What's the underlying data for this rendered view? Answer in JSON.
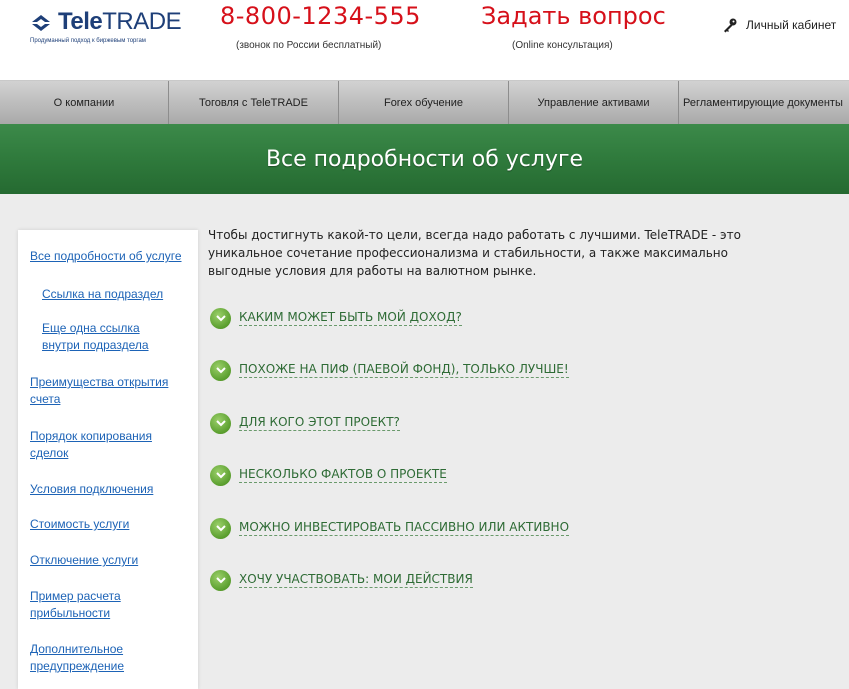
{
  "header": {
    "logo_text_bold": "Tele",
    "logo_text_rest": "TRADE",
    "logo_tagline": "Продуманный подход к биржевым торгам",
    "phone": "8-800-1234-555",
    "phone_note": "(звонок по России бесплатный)",
    "ask": "Задать вопрос",
    "ask_note": "(Online консультация)",
    "cabinet_label": "Личный кабинет",
    "accent_color": "#d6101a",
    "brand_color": "#1e3f78"
  },
  "nav": {
    "items": [
      {
        "label": "О компании"
      },
      {
        "label": "Тоговля с TeleTRADE"
      },
      {
        "label": "Forex обучение"
      },
      {
        "label": "Управление активами"
      },
      {
        "label": "Регламентирующие документы"
      }
    ]
  },
  "banner": {
    "title": "Все подробности об услуге",
    "color": "#2f7a3c"
  },
  "sidebar": {
    "items": [
      {
        "label": "Все подробности об услуге"
      },
      {
        "label": "Ссылка на подраздел"
      },
      {
        "label": "Еще одна ссылка внутри подраздела"
      },
      {
        "label": "Преимущества открытия счета"
      },
      {
        "label": "Порядок копирования сделок"
      },
      {
        "label": "Условия подключения"
      },
      {
        "label": "Стоимость услуги"
      },
      {
        "label": "Отключение услуги"
      },
      {
        "label": "Пример расчета прибыльности"
      },
      {
        "label": "Дополнительное предупреждение"
      }
    ]
  },
  "main": {
    "intro": "Чтобы достигнуть какой-то цели, всегда надо работать с лучшими. TeleTRADE - это уникальное сочетание профессионализма и стабильности, а также максимально выгодные условия для работы на валютном рынке.",
    "accordion": [
      {
        "label": "КАКИМ МОЖЕТ БЫТЬ МОЙ ДОХОД?",
        "icon": "chevron-down-icon"
      },
      {
        "label": "ПОХОЖЕ НА ПИФ (ПАЕВОЙ ФОНД), ТОЛЬКО ЛУЧШЕ!",
        "icon": "chevron-down-icon"
      },
      {
        "label": "ДЛЯ КОГО ЭТОТ ПРОЕКТ?",
        "icon": "chevron-down-icon"
      },
      {
        "label": "НЕСКОЛЬКО ФАКТОВ О ПРОЕКТЕ",
        "icon": "chevron-down-icon"
      },
      {
        "label": "МОЖНО ИНВЕСТИРОВАТЬ ПАССИВНО ИЛИ АКТИВНО",
        "icon": "chevron-down-icon"
      },
      {
        "label": "ХОЧУ УЧАСТВОВАТЬ: МОИ ДЕЙСТВИЯ",
        "icon": "chevron-down-icon"
      }
    ]
  }
}
